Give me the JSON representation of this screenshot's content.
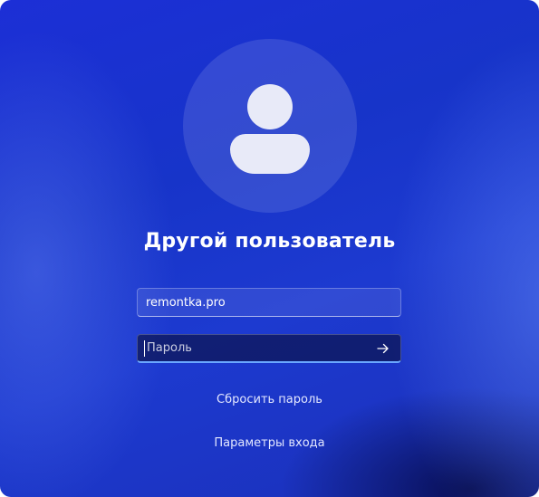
{
  "user": {
    "avatar_icon": "user-avatar-icon",
    "title": "Другой пользователь"
  },
  "login_form": {
    "username_value": "remontka.pro",
    "password_placeholder": "Пароль",
    "submit_icon": "arrow-right-icon"
  },
  "links": {
    "reset_password": "Сбросить пароль",
    "sign_in_options": "Параметры входа"
  },
  "colors": {
    "background": "#1c32cf",
    "focus_underline": "#6aa7ff",
    "avatar_glyph": "#e8eaf8"
  }
}
